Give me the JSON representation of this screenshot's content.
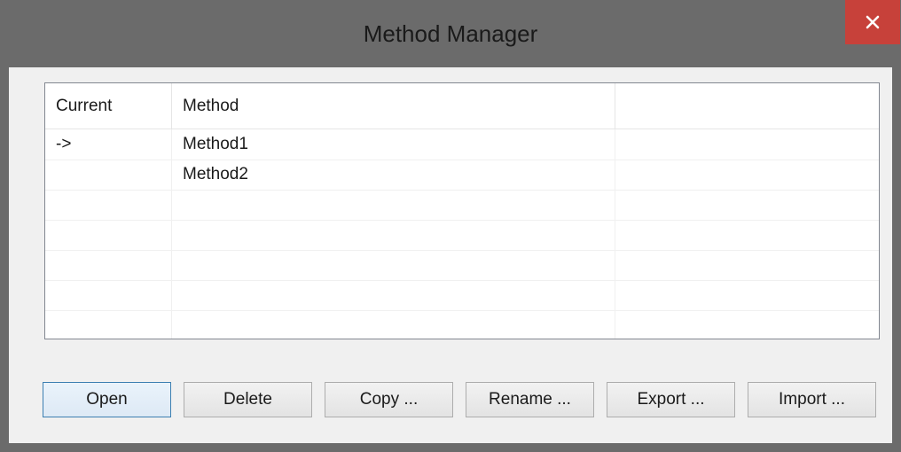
{
  "window": {
    "title": "Method Manager",
    "close_glyph": "✕"
  },
  "list": {
    "columns": [
      "Current",
      "Method",
      ""
    ],
    "rows": [
      [
        "->",
        "Method1",
        ""
      ],
      [
        "",
        "Method2",
        ""
      ],
      [
        "",
        "",
        ""
      ],
      [
        "",
        "",
        ""
      ],
      [
        "",
        "",
        ""
      ],
      [
        "",
        "",
        ""
      ],
      [
        "",
        "",
        ""
      ]
    ]
  },
  "buttons": {
    "open": "Open",
    "delete": "Delete",
    "copy": "Copy ...",
    "rename": "Rename ...",
    "export": "Export ...",
    "import": "Import ..."
  },
  "colors": {
    "titlebar": "#6b6b6b",
    "close_button": "#c7413a",
    "client": "#f0f0f0",
    "default_button_border": "#3c7fb1"
  }
}
